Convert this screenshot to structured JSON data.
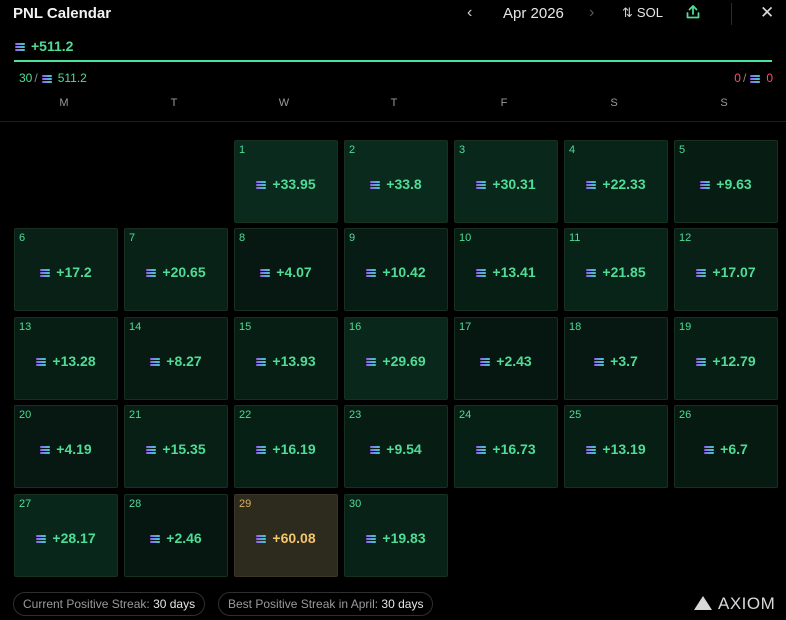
{
  "header": {
    "title": "PNL Calendar",
    "prev_icon": "‹",
    "month": "Apr 2026",
    "next_icon": "›",
    "sort_icon": "⇅",
    "currency": "SOL",
    "share_icon": "share-icon",
    "close_icon": "✕"
  },
  "summary": {
    "total": "+511.2",
    "wins": "30",
    "wins_amount": "511.2",
    "losses": "0",
    "losses_amount": "0",
    "progress_fraction": 1.0
  },
  "weekdays": [
    "M",
    "T",
    "W",
    "T",
    "F",
    "S",
    "S"
  ],
  "days": [
    {
      "day": "1",
      "value": "+33.95"
    },
    {
      "day": "2",
      "value": "+33.8"
    },
    {
      "day": "3",
      "value": "+30.31"
    },
    {
      "day": "4",
      "value": "+22.33"
    },
    {
      "day": "5",
      "value": "+9.63"
    },
    {
      "day": "6",
      "value": "+17.2"
    },
    {
      "day": "7",
      "value": "+20.65"
    },
    {
      "day": "8",
      "value": "+4.07"
    },
    {
      "day": "9",
      "value": "+10.42"
    },
    {
      "day": "10",
      "value": "+13.41"
    },
    {
      "day": "11",
      "value": "+21.85"
    },
    {
      "day": "12",
      "value": "+17.07"
    },
    {
      "day": "13",
      "value": "+13.28"
    },
    {
      "day": "14",
      "value": "+8.27"
    },
    {
      "day": "15",
      "value": "+13.93"
    },
    {
      "day": "16",
      "value": "+29.69"
    },
    {
      "day": "17",
      "value": "+2.43"
    },
    {
      "day": "18",
      "value": "+3.7"
    },
    {
      "day": "19",
      "value": "+12.79"
    },
    {
      "day": "20",
      "value": "+4.19"
    },
    {
      "day": "21",
      "value": "+15.35"
    },
    {
      "day": "22",
      "value": "+16.19"
    },
    {
      "day": "23",
      "value": "+9.54"
    },
    {
      "day": "24",
      "value": "+16.73"
    },
    {
      "day": "25",
      "value": "+13.19"
    },
    {
      "day": "26",
      "value": "+6.7"
    },
    {
      "day": "27",
      "value": "+28.17"
    },
    {
      "day": "28",
      "value": "+2.46"
    },
    {
      "day": "29",
      "value": "+60.08",
      "highlight": true
    },
    {
      "day": "30",
      "value": "+19.83"
    }
  ],
  "footer": {
    "current_streak_label": "Current Positive Streak:",
    "current_streak_value": "30 days",
    "best_streak_label": "Best Positive Streak in April:",
    "best_streak_value": "30 days",
    "brand": "AXIOM"
  },
  "colors": {
    "positive": "#4fdc96",
    "negative": "#ff4d6a",
    "highlight": "#f2c66a",
    "background": "#000000"
  }
}
